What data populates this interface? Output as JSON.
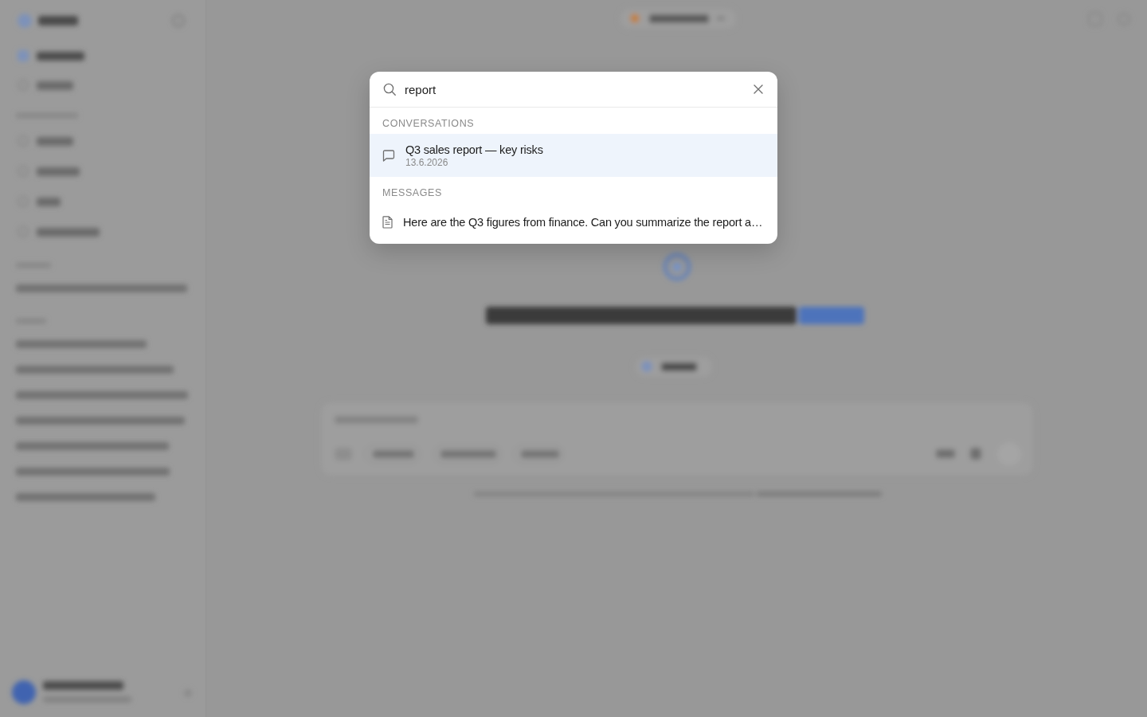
{
  "search_dialog": {
    "query": "report",
    "sections": [
      {
        "heading": "CONVERSATIONS",
        "results": [
          {
            "kind": "conversation",
            "title": "Q3 sales report — key risks",
            "date": "13.6.2026",
            "selected": true
          }
        ]
      },
      {
        "heading": "MESSAGES",
        "results": [
          {
            "kind": "message",
            "title": "Here are the Q3 figures from finance. Can you summarize the report a…",
            "selected": false
          }
        ]
      }
    ]
  }
}
